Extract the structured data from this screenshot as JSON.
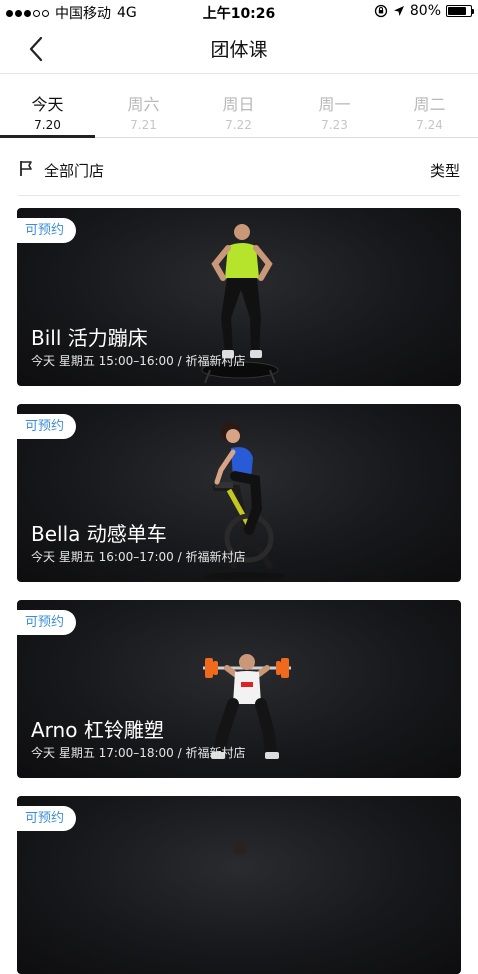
{
  "status": {
    "carrier": "中国移动",
    "network": "4G",
    "time": "上午10:26",
    "battery": "80%",
    "signal_bars_filled": 3,
    "signal_bars_total": 5
  },
  "nav": {
    "title": "团体课"
  },
  "tabs": [
    {
      "name": "今天",
      "date": "7.20",
      "active": true
    },
    {
      "name": "周六",
      "date": "7.21"
    },
    {
      "name": "周日",
      "date": "7.22"
    },
    {
      "name": "周一",
      "date": "7.23"
    },
    {
      "name": "周二",
      "date": "7.24"
    }
  ],
  "filter": {
    "store": "全部门店",
    "type": "类型"
  },
  "cards": [
    {
      "badge": "可预约",
      "course": "Bill 活力蹦床",
      "meta": "今天  星期五 15:00–16:00 / 祈福新村店"
    },
    {
      "badge": "可预约",
      "course": "Bella 动感单车",
      "meta": "今天  星期五 16:00–17:00 / 祈福新村店"
    },
    {
      "badge": "可预约",
      "course": "Arno 杠铃雕塑",
      "meta": "今天  星期五 17:00–18:00 / 祈福新村店"
    },
    {
      "badge": "可预约",
      "course": "",
      "meta": ""
    }
  ],
  "colors": {
    "accent": "#3b8fd9",
    "card_bg": "#17181b",
    "tab_active": "#222222"
  }
}
